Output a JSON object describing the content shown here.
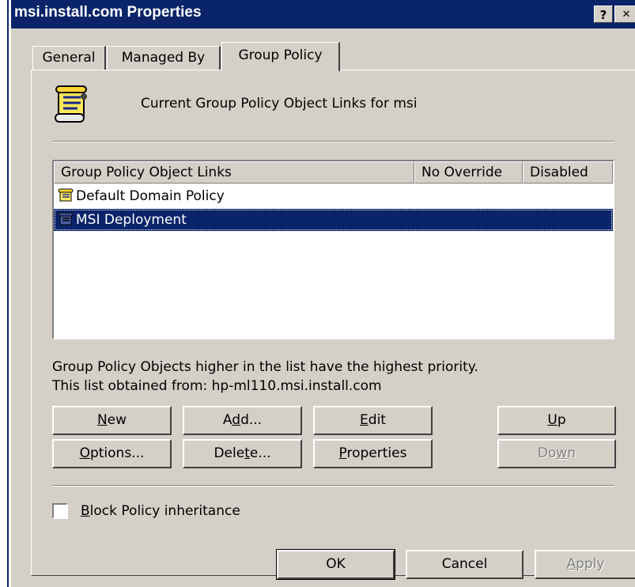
{
  "window": {
    "title": "msi.install.com Properties",
    "help_glyph": "?",
    "close_glyph": "✕"
  },
  "tabs": [
    {
      "label": "General",
      "active": false
    },
    {
      "label": "Managed By",
      "active": false
    },
    {
      "label": "Group Policy",
      "active": true
    }
  ],
  "header_text": "Current Group Policy Object Links for msi",
  "list": {
    "columns": [
      "Group Policy Object Links",
      "No Override",
      "Disabled"
    ],
    "rows": [
      {
        "name": "Default Domain Policy",
        "no_override": "",
        "disabled": "",
        "selected": false
      },
      {
        "name": "MSI Deployment",
        "no_override": "",
        "disabled": "",
        "selected": true
      }
    ]
  },
  "info": {
    "line1": "Group Policy Objects higher in the list have the highest priority.",
    "line2": "This list obtained from: hp-ml110.msi.install.com"
  },
  "buttons": {
    "new": {
      "pre": "",
      "key": "N",
      "post": "ew"
    },
    "add": {
      "pre": "A",
      "key": "d",
      "post": "d..."
    },
    "edit": {
      "pre": "",
      "key": "E",
      "post": "dit"
    },
    "up": {
      "pre": "",
      "key": "U",
      "post": "p"
    },
    "options": {
      "pre": "",
      "key": "O",
      "post": "ptions..."
    },
    "delete": {
      "pre": "Dele",
      "key": "t",
      "post": "e..."
    },
    "properties": {
      "pre": "",
      "key": "P",
      "post": "roperties"
    },
    "down": {
      "pre": "Do",
      "key": "w",
      "post": "n"
    }
  },
  "block_inheritance": {
    "pre": "",
    "key": "B",
    "post": "lock Policy inheritance",
    "checked": false
  },
  "footer": {
    "ok": "OK",
    "cancel": "Cancel",
    "apply": {
      "pre": "",
      "key": "A",
      "post": "pply"
    }
  },
  "icon": "group-policy-scroll-icon"
}
